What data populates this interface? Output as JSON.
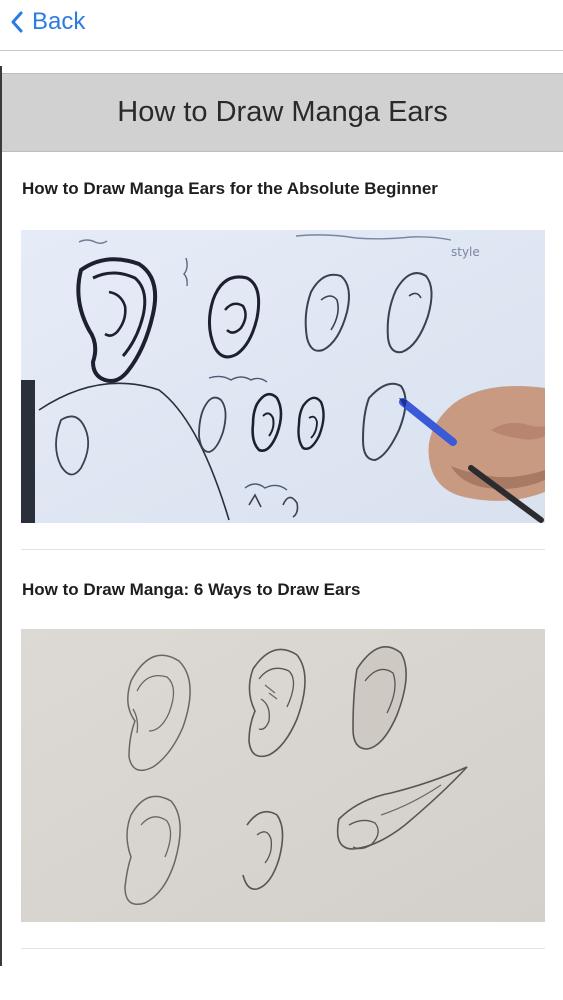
{
  "nav": {
    "back_label": "Back",
    "back_icon": "chevron-left-icon",
    "accent_color": "#2b7be3"
  },
  "page": {
    "title": "How to Draw Manga Ears"
  },
  "videos": [
    {
      "title": "How to Draw Manga Ears for the Absolute Beginner",
      "thumbnail": "sketch-of-anime-ears-with-hand-holding-pencil",
      "scribble_word": "style"
    },
    {
      "title": "How to Draw Manga: 6 Ways to Draw Ears",
      "thumbnail": "six-pencil-sketches-of-manga-ears"
    }
  ]
}
